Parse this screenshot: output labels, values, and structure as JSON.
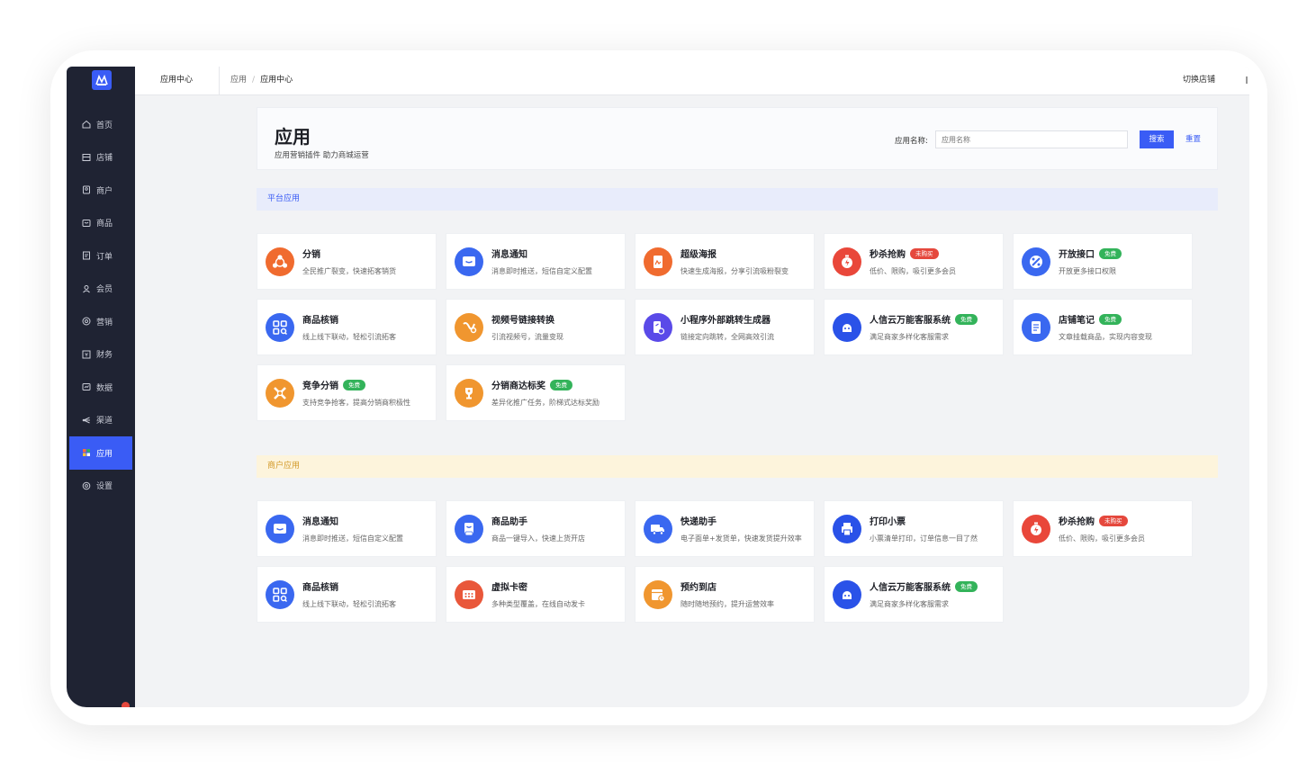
{
  "colors": {
    "accent": "#3a5cf5",
    "sidebar_bg": "#1f2333",
    "free_tag": "#33b35a",
    "buy_tag": "#e5483d"
  },
  "sidebar": {
    "items": [
      {
        "label": "首页",
        "icon": "home-icon"
      },
      {
        "label": "店铺",
        "icon": "store-icon"
      },
      {
        "label": "商户",
        "icon": "merchant-icon"
      },
      {
        "label": "商品",
        "icon": "goods-icon"
      },
      {
        "label": "订单",
        "icon": "order-icon"
      },
      {
        "label": "会员",
        "icon": "member-icon"
      },
      {
        "label": "营销",
        "icon": "marketing-icon"
      },
      {
        "label": "财务",
        "icon": "finance-icon"
      },
      {
        "label": "数据",
        "icon": "data-icon"
      },
      {
        "label": "渠道",
        "icon": "channel-icon"
      },
      {
        "label": "应用",
        "icon": "apps-icon",
        "active": true
      },
      {
        "label": "设置",
        "icon": "settings-icon"
      }
    ]
  },
  "topbar": {
    "title": "应用中心",
    "breadcrumb": [
      "应用",
      "应用中心"
    ],
    "switch_store": "切换店铺"
  },
  "header": {
    "title": "应用",
    "subtitle": "应用营销插件 助力商城运营",
    "search_label": "应用名称:",
    "search_placeholder": "应用名称",
    "search_button": "搜索",
    "reset_button": "重置"
  },
  "sections": [
    {
      "title": "平台应用",
      "apps": [
        {
          "name": "分销",
          "desc": "全民推广裂变，快速拓客销货",
          "icon": "share-network-icon",
          "color": "#f06b2f"
        },
        {
          "name": "消息通知",
          "desc": "消息即时推送，短信自定义配置",
          "icon": "message-icon",
          "color": "#3a68f0"
        },
        {
          "name": "超级海报",
          "desc": "快速生成海报，分享引流吸粉裂变",
          "icon": "poster-icon",
          "color": "#f06b2f"
        },
        {
          "name": "秒杀抢购",
          "desc": "低价、限购，吸引更多会员",
          "icon": "flash-sale-icon",
          "color": "#e9473a",
          "tag": "未购买",
          "tag_type": "buy"
        },
        {
          "name": "开放接口",
          "desc": "开放更多接口权限",
          "icon": "api-icon",
          "color": "#3a68f0",
          "tag": "免费",
          "tag_type": "free"
        },
        {
          "name": "商品核销",
          "desc": "线上线下联动，轻松引流拓客",
          "icon": "qr-verify-icon",
          "color": "#3a68f0"
        },
        {
          "name": "视频号链接转换",
          "desc": "引流视频号，流量变现",
          "icon": "video-link-icon",
          "color": "#f0962f"
        },
        {
          "name": "小程序外部跳转生成器",
          "desc": "链接定向跳转，全网高效引流",
          "icon": "mini-program-jump-icon",
          "color": "#5a4ae8"
        },
        {
          "name": "人信云万能客服系统",
          "desc": "满足商家多样化客服需求",
          "icon": "customer-service-icon",
          "color": "#2a52e8",
          "tag": "免费",
          "tag_type": "free"
        },
        {
          "name": "店铺笔记",
          "desc": "文章挂载商品，实现内容变现",
          "icon": "note-icon",
          "color": "#3a68f0",
          "tag": "免费",
          "tag_type": "free"
        },
        {
          "name": "竞争分销",
          "desc": "支持竞争抢客，提高分销商积极性",
          "icon": "compete-icon",
          "color": "#f0962f",
          "tag": "免费",
          "tag_type": "free"
        },
        {
          "name": "分销商达标奖",
          "desc": "差异化推广任务，阶梯式达标奖励",
          "icon": "trophy-icon",
          "color": "#f0962f",
          "tag": "免费",
          "tag_type": "free"
        }
      ]
    },
    {
      "title": "商户应用",
      "apps": [
        {
          "name": "消息通知",
          "desc": "消息即时推送，短信自定义配置",
          "icon": "message-icon",
          "color": "#3a68f0"
        },
        {
          "name": "商品助手",
          "desc": "商品一键导入，快速上货开店",
          "icon": "goods-helper-icon",
          "color": "#3a68f0"
        },
        {
          "name": "快递助手",
          "desc": "电子面单+发货单，快速发货提升效率",
          "icon": "delivery-truck-icon",
          "color": "#3a68f0"
        },
        {
          "name": "打印小票",
          "desc": "小票清单打印，订单信息一目了然",
          "icon": "printer-icon",
          "color": "#2a52e8"
        },
        {
          "name": "秒杀抢购",
          "desc": "低价、限购，吸引更多会员",
          "icon": "flash-sale-icon",
          "color": "#e9473a",
          "tag": "未购买",
          "tag_type": "buy"
        },
        {
          "name": "商品核销",
          "desc": "线上线下联动，轻松引流拓客",
          "icon": "qr-verify-icon",
          "color": "#3a68f0"
        },
        {
          "name": "虚拟卡密",
          "desc": "多种类型覆盖，在线自动发卡",
          "icon": "virtual-card-icon",
          "color": "#e9573a"
        },
        {
          "name": "预约到店",
          "desc": "随时随地预约，提升运营效率",
          "icon": "booking-calendar-icon",
          "color": "#f0962f"
        },
        {
          "name": "人信云万能客服系统",
          "desc": "满足商家多样化客服需求",
          "icon": "customer-service-icon",
          "color": "#2a52e8",
          "tag": "免费",
          "tag_type": "free"
        }
      ]
    }
  ]
}
